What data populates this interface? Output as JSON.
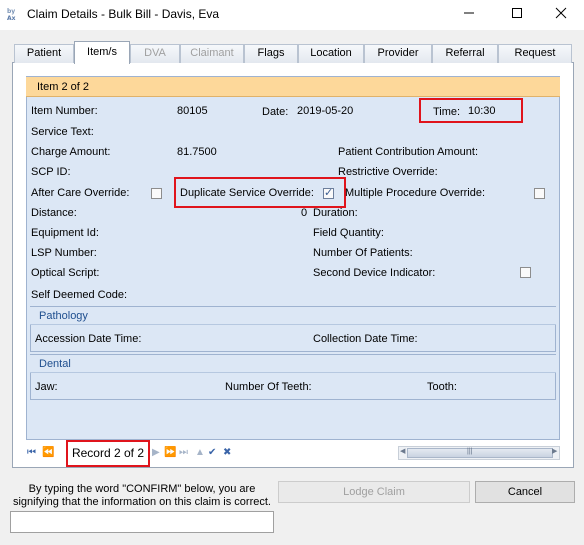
{
  "window": {
    "title": "Claim Details - Bulk Bill - Davis, Eva",
    "minimize": "—",
    "maximize": "☐",
    "close": "✕"
  },
  "tabs": [
    {
      "label": "Patient",
      "active": false,
      "enabled": true
    },
    {
      "label": "Item/s",
      "active": true,
      "enabled": true
    },
    {
      "label": "DVA",
      "active": false,
      "enabled": false
    },
    {
      "label": "Claimant",
      "active": false,
      "enabled": false
    },
    {
      "label": "Flags",
      "active": false,
      "enabled": true
    },
    {
      "label": "Location",
      "active": false,
      "enabled": true
    },
    {
      "label": "Provider",
      "active": false,
      "enabled": true
    },
    {
      "label": "Referral",
      "active": false,
      "enabled": true
    },
    {
      "label": "Request",
      "active": false,
      "enabled": true
    }
  ],
  "item": {
    "header": "Item 2 of 2",
    "item_number_label": "Item Number:",
    "item_number": "80105",
    "date_label": "Date:",
    "date": "2019-05-20",
    "time_label": "Time:",
    "time": "10:30",
    "service_text_label": "Service Text:",
    "charge_amount_label": "Charge Amount:",
    "charge_amount": "81.7500",
    "patient_contribution_label": "Patient Contribution Amount:",
    "scp_id_label": "SCP ID:",
    "restrictive_override_label": "Restrictive Override:",
    "after_care_override_label": "After Care Override:",
    "after_care_override_checked": false,
    "duplicate_service_override_label": "Duplicate Service Override:",
    "duplicate_service_override_checked": true,
    "multiple_procedure_override_label": "Multiple Procedure Override:",
    "multiple_procedure_override_checked": false,
    "distance_label": "Distance:",
    "distance": "0",
    "duration_label": "Duration:",
    "equipment_id_label": "Equipment Id:",
    "field_quantity_label": "Field Quantity:",
    "lsp_number_label": "LSP Number:",
    "number_of_patients_label": "Number Of Patients:",
    "optical_script_label": "Optical Script:",
    "second_device_indicator_label": "Second Device Indicator:",
    "second_device_indicator_checked": false,
    "self_deemed_code_label": "Self Deemed Code:"
  },
  "pathology": {
    "title": "Pathology",
    "accession_label": "Accession Date Time:",
    "collection_label": "Collection Date Time:"
  },
  "dental": {
    "title": "Dental",
    "jaw_label": "Jaw:",
    "teeth_label": "Number Of Teeth:",
    "tooth_label": "Tooth:"
  },
  "navigator": {
    "first": "⏮",
    "prev_page": "⏪",
    "record_text": "Record 2 of 2",
    "next": "▶",
    "next_page": "⏩",
    "last": "⏭",
    "up": "▲",
    "confirm": "✔",
    "cancel": "✖"
  },
  "footer": {
    "confirm_text": "By typing the word \"CONFIRM\" below, you are signifying that the information on this claim is correct.",
    "confirm_input_value": "",
    "lodge_label": "Lodge Claim",
    "cancel_label": "Cancel"
  },
  "colors": {
    "item_header_bg": "#fdd89a",
    "panel_bg": "#dce7f5",
    "group_title": "#1f4f8f",
    "highlight_border": "#e0141c"
  }
}
